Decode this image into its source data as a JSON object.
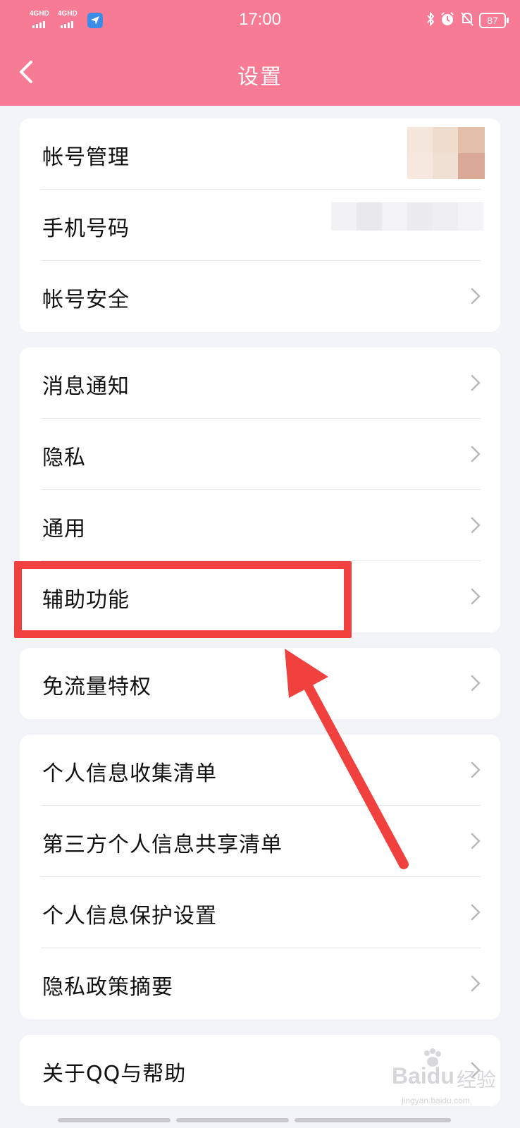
{
  "status_bar": {
    "signal_1_label": "4GHD",
    "signal_2_label": "4GHD",
    "time": "17:00",
    "battery": "87",
    "icons": [
      "sim-app-icon",
      "bluetooth-icon",
      "alarm-icon",
      "mute-bell-icon",
      "battery-icon"
    ]
  },
  "nav": {
    "back_icon": "chevron-left-icon",
    "title": "设置"
  },
  "groups": [
    {
      "items": [
        {
          "label": "帐号管理"
        },
        {
          "label": "手机号码"
        },
        {
          "label": "帐号安全"
        }
      ]
    },
    {
      "items": [
        {
          "label": "消息通知"
        },
        {
          "label": "隐私"
        },
        {
          "label": "通用"
        },
        {
          "label": "辅助功能"
        }
      ]
    },
    {
      "items": [
        {
          "label": "免流量特权"
        }
      ]
    },
    {
      "items": [
        {
          "label": "个人信息收集清单"
        },
        {
          "label": "第三方个人信息共享清单"
        },
        {
          "label": "个人信息保护设置"
        },
        {
          "label": "隐私政策摘要"
        }
      ]
    },
    {
      "items": [
        {
          "label": "关于QQ与帮助"
        }
      ]
    }
  ],
  "annotation": {
    "highlighted_item": "辅助功能",
    "color": "#f0413f"
  },
  "watermark": {
    "brand": "Baidu",
    "cn": "经验",
    "site": "jingyan.baidu.com"
  },
  "colors": {
    "header": "#f77b94",
    "background": "#f3f4f8",
    "chevron": "#b8b8bd"
  }
}
